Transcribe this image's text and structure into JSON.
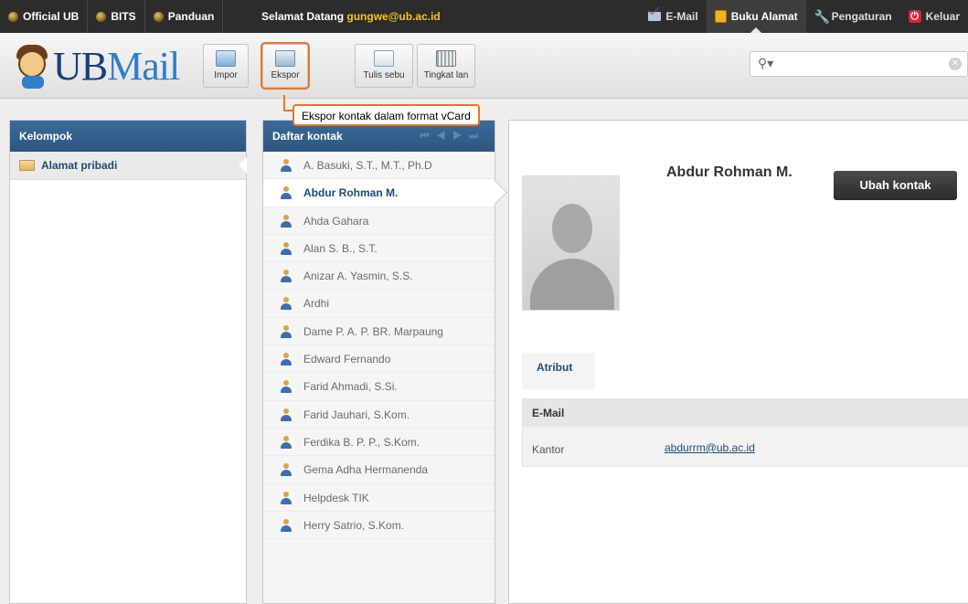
{
  "topbar": {
    "links": [
      "Official UB",
      "BITS",
      "Panduan"
    ],
    "welcome_prefix": "Selamat Datang",
    "user": "gungwe@ub.ac.id",
    "nav": [
      "E-Mail",
      "Buku Alamat",
      "Pengaturan",
      "Keluar"
    ]
  },
  "logo": {
    "brand_ub": "UB",
    "brand_mail": "Mail"
  },
  "toolbar": {
    "impor": "Impor",
    "ekspor": "Ekspor",
    "tulis": "Tulis sebu",
    "tingkat": "Tingkat lan"
  },
  "search": {
    "placeholder": ""
  },
  "tooltip": "Ekspor kontak dalam format vCard",
  "groups": {
    "title": "Kelompok",
    "items": [
      "Alamat pribadi"
    ]
  },
  "contacts": {
    "title": "Daftar kontak",
    "items": [
      "A. Basuki, S.T., M.T., Ph.D",
      "Abdur Rohman M.",
      "Ahda Gahara",
      "Alan S. B., S.T.",
      "Anizar A. Yasmin, S.S.",
      "Ardhi",
      "Dame P. A. P. BR. Marpaung",
      "Edward Fernando",
      "Farid Ahmadi, S.Si.",
      "Farid Jauhari, S.Kom.",
      "Ferdika B. P. P., S.Kom.",
      "Gema Adha Hermanenda",
      "Helpdesk TIK",
      "Herry Satrio, S.Kom."
    ],
    "selected_index": 1
  },
  "detail": {
    "name": "Abdur Rohman M.",
    "edit_button": "Ubah kontak",
    "tab": "Atribut",
    "section": "E-Mail",
    "field_label": "Kantor",
    "field_value": "abdurrm@ub.ac.id"
  },
  "colors": {
    "accent": "#e87722",
    "panel_header": "#2d5680",
    "user_highlight": "#f6c71a"
  }
}
